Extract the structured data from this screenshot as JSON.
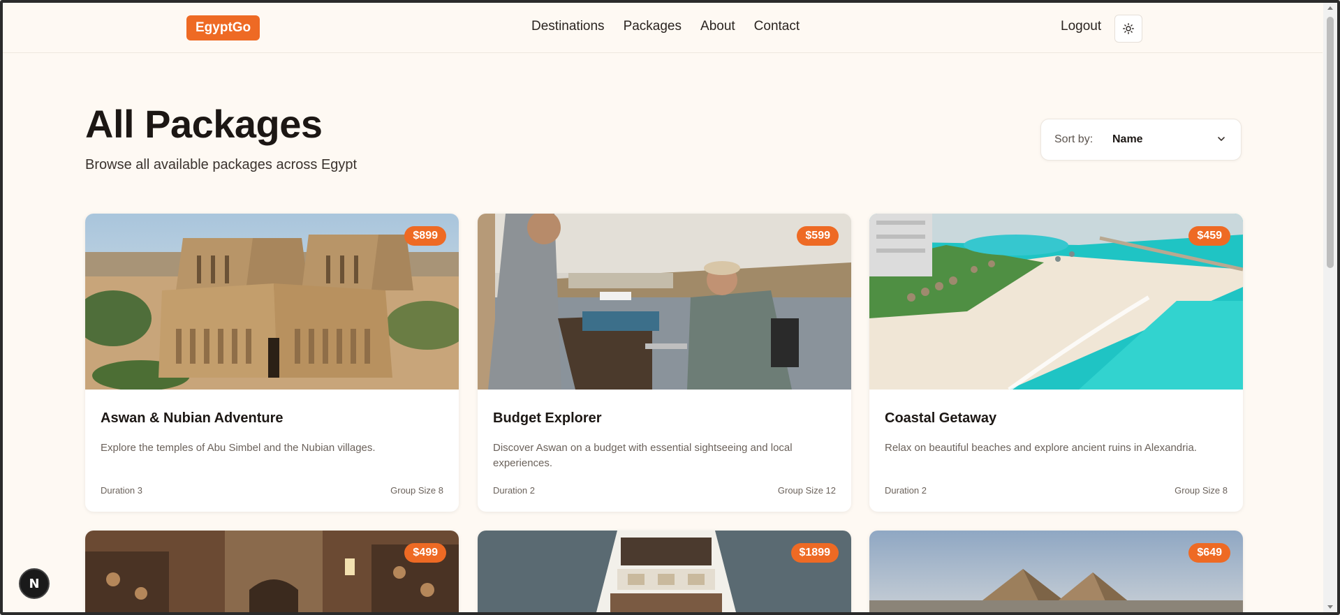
{
  "header": {
    "logo": "EgyptGo",
    "nav": [
      "Destinations",
      "Packages",
      "About",
      "Contact"
    ],
    "logout": "Logout",
    "theme_icon": "sun-icon"
  },
  "page": {
    "title": "All Packages",
    "subtitle": "Browse all available packages across Egypt"
  },
  "sort": {
    "label": "Sort by:",
    "value": "Name",
    "icon": "chevron-down-icon"
  },
  "packages": [
    {
      "price": "$899",
      "title": "Aswan & Nubian Adventure",
      "description": "Explore the temples of Abu Simbel and the Nubian villages.",
      "duration": "Duration 3",
      "group": "Group Size 8"
    },
    {
      "price": "$599",
      "title": "Budget Explorer",
      "description": "Discover Aswan on a budget with essential sightseeing and local experiences.",
      "duration": "Duration 2",
      "group": "Group Size 12"
    },
    {
      "price": "$459",
      "title": "Coastal Getaway",
      "description": "Relax on beautiful beaches and explore ancient ruins in Alexandria.",
      "duration": "Duration 2",
      "group": "Group Size 8"
    },
    {
      "price": "$499"
    },
    {
      "price": "$1899"
    },
    {
      "price": "$649"
    }
  ],
  "colors": {
    "accent": "#ee6a24",
    "background": "#fef9f3"
  },
  "dev_badge": "N"
}
